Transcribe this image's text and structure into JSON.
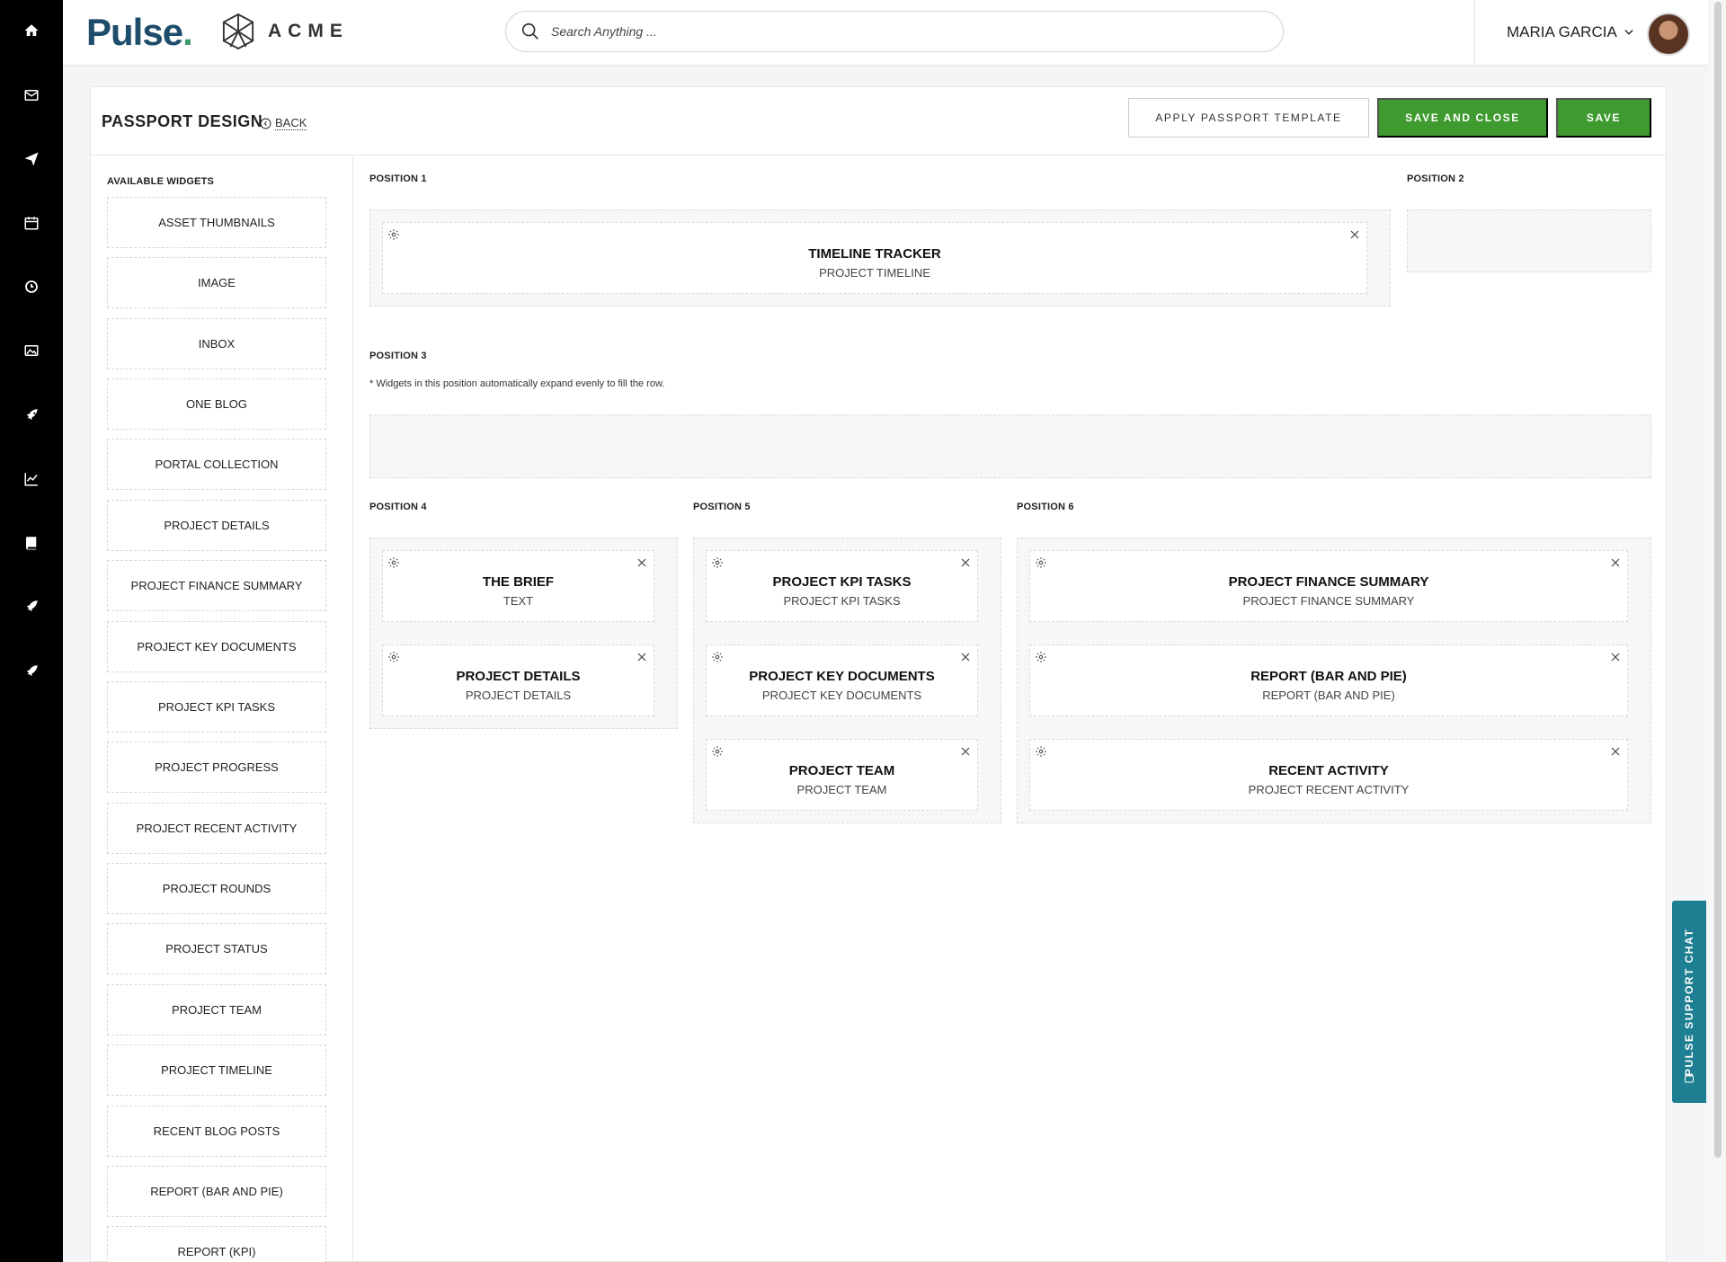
{
  "rail": {
    "items": [
      {
        "icon": "home-icon"
      },
      {
        "icon": "mail-icon"
      },
      {
        "icon": "send-icon"
      },
      {
        "icon": "calendar-icon"
      },
      {
        "icon": "clock-icon"
      },
      {
        "icon": "image-icon"
      },
      {
        "icon": "rocket-icon"
      },
      {
        "icon": "chart-icon"
      },
      {
        "icon": "book-icon"
      },
      {
        "icon": "rocket-icon"
      },
      {
        "icon": "rocket-icon"
      }
    ]
  },
  "header": {
    "brand": "Pulse",
    "partner": "ACME",
    "search_placeholder": "Search Anything ...",
    "user_name": "MARIA GARCIA"
  },
  "page": {
    "title": "PASSPORT DESIGN",
    "back_label": "BACK",
    "apply_template_label": "APPLY PASSPORT TEMPLATE",
    "save_close_label": "SAVE AND CLOSE",
    "save_label": "SAVE",
    "accent_color": "#3f9a30"
  },
  "available_widgets": {
    "label": "AVAILABLE WIDGETS",
    "items": [
      "ASSET THUMBNAILS",
      "IMAGE",
      "INBOX",
      "ONE BLOG",
      "PORTAL COLLECTION",
      "PROJECT DETAILS",
      "PROJECT FINANCE SUMMARY",
      "PROJECT KEY DOCUMENTS",
      "PROJECT KPI TASKS",
      "PROJECT PROGRESS",
      "PROJECT RECENT ACTIVITY",
      "PROJECT ROUNDS",
      "PROJECT STATUS",
      "PROJECT TEAM",
      "PROJECT TIMELINE",
      "RECENT BLOG POSTS",
      "REPORT (BAR AND PIE)",
      "REPORT (KPI)"
    ]
  },
  "positions": {
    "p1": {
      "label": "POSITION 1",
      "widgets": [
        {
          "title": "TIMELINE TRACKER",
          "sub": "PROJECT TIMELINE"
        }
      ]
    },
    "p2": {
      "label": "POSITION 2"
    },
    "p3": {
      "label": "POSITION 3",
      "note": "* Widgets in this position automatically expand evenly to fill the row."
    },
    "p4": {
      "label": "POSITION 4",
      "widgets": [
        {
          "title": "THE BRIEF",
          "sub": "TEXT"
        },
        {
          "title": "PROJECT DETAILS",
          "sub": "PROJECT DETAILS"
        }
      ]
    },
    "p5": {
      "label": "POSITION 5",
      "widgets": [
        {
          "title": "PROJECT KPI TASKS",
          "sub": "PROJECT KPI TASKS"
        },
        {
          "title": "PROJECT KEY DOCUMENTS",
          "sub": "PROJECT KEY DOCUMENTS"
        },
        {
          "title": "PROJECT TEAM",
          "sub": "PROJECT TEAM"
        }
      ]
    },
    "p6": {
      "label": "POSITION 6",
      "widgets": [
        {
          "title": "PROJECT FINANCE SUMMARY",
          "sub": "PROJECT FINANCE SUMMARY"
        },
        {
          "title": "REPORT (BAR AND PIE)",
          "sub": "REPORT (BAR AND PIE)"
        },
        {
          "title": "RECENT ACTIVITY",
          "sub": "PROJECT RECENT ACTIVITY"
        }
      ]
    }
  },
  "support": {
    "label": "PULSE SUPPORT CHAT",
    "color": "#1f7f92"
  }
}
